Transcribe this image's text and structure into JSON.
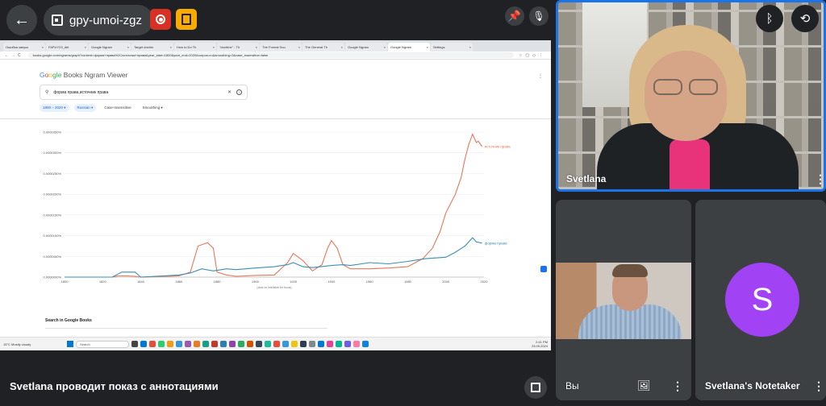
{
  "meeting": {
    "code": "gpy-umoi-zgz"
  },
  "presenter_label": "Svetlana проводит показ с аннотациями",
  "browser": {
    "tabs": [
      "Ошибка запуск",
      "FAPUY23_det",
      "Google Ngram",
      "Target doctrin",
      "How to Do Th",
      "\"doctrine\" - Th",
      "The Formal Sou",
      "The General Th",
      "Google Ngram",
      "Google Ngram",
      "Settings"
    ],
    "active_tab_index": 9,
    "url": "books.google.com/ngrams/graph?content=форма+права%2Cисточник+права&year_start=1800&year_end=2020&corpus=ru&smoothing=3&case_insensitive=false"
  },
  "ngram": {
    "logo": {
      "g1": "G",
      "g2": "o",
      "g3": "o",
      "g4": "gle",
      "rest": " Books Ngram Viewer"
    },
    "query": "форма права,источник права",
    "chips": {
      "years": "1800 – 2020 ▾",
      "corpus": "Russian ▾",
      "case": "Case-Insensitive",
      "smoothing": "Smoothing ▾"
    },
    "search_books": "Search in Google Books"
  },
  "chart_data": {
    "type": "line",
    "x_ticks": [
      "1800",
      "1820",
      "1840",
      "1860",
      "1880",
      "1900",
      "1920",
      "1940",
      "1960",
      "1980",
      "2000",
      "2020"
    ],
    "y_ticks": [
      "0.0000000%",
      "0.0000050%",
      "0.0000100%",
      "0.0000150%",
      "0.0000200%",
      "0.0000250%",
      "0.0000300%",
      "0.0000350%"
    ],
    "ylim": [
      0,
      3.5e-05
    ],
    "note": "(click on line/label for focus)",
    "series": [
      {
        "name": "источник права",
        "color": "#e8775a",
        "x": [
          1800,
          1825,
          1828,
          1833,
          1837,
          1840,
          1860,
          1866,
          1870,
          1875,
          1878,
          1880,
          1885,
          1890,
          1900,
          1910,
          1917,
          1920,
          1925,
          1930,
          1935,
          1938,
          1940,
          1943,
          1946,
          1950,
          1960,
          1970,
          1980,
          1988,
          1993,
          1997,
          2000,
          2005,
          2008,
          2010,
          2012,
          2014,
          2016,
          2017,
          2019
        ],
        "y": [
          0,
          0,
          3e-07,
          3e-07,
          2e-07,
          0,
          3e-07,
          1.2e-06,
          7.5e-06,
          8.3e-06,
          7e-06,
          1.2e-06,
          5e-07,
          2e-07,
          4e-07,
          5e-07,
          3.5e-06,
          5.7e-06,
          4e-06,
          1.5e-06,
          3e-06,
          7e-06,
          8.8e-06,
          7e-06,
          3e-06,
          2e-06,
          2e-06,
          2.2e-06,
          2.5e-06,
          4.5e-06,
          7e-06,
          1.1e-05,
          1.55e-05,
          2e-05,
          2.4e-05,
          2.85e-05,
          3.2e-05,
          3.45e-05,
          3.25e-05,
          3.28e-05,
          3.15e-05
        ]
      },
      {
        "name": "форма права",
        "color": "#3b8fb5",
        "x": [
          1800,
          1825,
          1830,
          1837,
          1840,
          1860,
          1866,
          1872,
          1878,
          1885,
          1890,
          1900,
          1910,
          1917,
          1920,
          1925,
          1930,
          1940,
          1946,
          1950,
          1960,
          1970,
          1980,
          1990,
          2000,
          2005,
          2010,
          2014,
          2016,
          2019
        ],
        "y": [
          0,
          0,
          1.2e-06,
          1.2e-06,
          0,
          5e-07,
          1e-06,
          2e-06,
          1.5e-06,
          2e-06,
          1.8e-06,
          2.2e-06,
          2.5e-06,
          3e-06,
          3.5e-06,
          2.5e-06,
          2.3e-06,
          2.8e-06,
          3e-06,
          2.8e-06,
          3.5e-06,
          3.2e-06,
          3.8e-06,
          4.5e-06,
          4.8e-06,
          6e-06,
          7.5e-06,
          9.5e-06,
          8.5e-06,
          8.2e-06
        ]
      }
    ]
  },
  "taskbar": {
    "weather": "15°C Mostly cloudy",
    "search": "Search",
    "time": "2:41 PM",
    "date": "23.09.2024"
  },
  "participants": [
    {
      "name": "Svetlana"
    },
    {
      "name": "Вы"
    },
    {
      "name": "Svetlana's Notetaker",
      "initial": "S"
    }
  ],
  "colors": {
    "accent": "#1a73e8",
    "record": "#d93025",
    "activities": "#f9ab00",
    "avatar": "#a142f4"
  }
}
